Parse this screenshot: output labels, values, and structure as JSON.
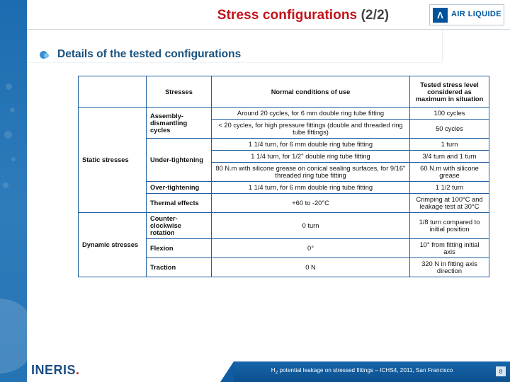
{
  "header": {
    "title_main": "Stress configurations",
    "title_suffix": "(2/2)",
    "logo": {
      "mark": "Λ",
      "line1": "AIR LIQUIDE"
    }
  },
  "section": {
    "bullet_icon": "bullet-dot-icon",
    "heading": "Details of the tested configurations"
  },
  "table": {
    "headers": {
      "blank": "",
      "stresses": "Stresses",
      "normal_conditions": "Normal conditions of use",
      "tested_level": "Tested stress level considered as maximum in situation"
    },
    "categories": [
      {
        "name": "Static stresses",
        "groups": [
          {
            "label": "Assembly-dismantling cycles",
            "rows": [
              {
                "condition": "Around 20 cycles, for 6 mm double ring tube fitting",
                "level": "100 cycles"
              },
              {
                "condition": "< 20 cycles, for high pressure fittings (double and threaded ring tube fittings)",
                "level": "50 cycles"
              }
            ]
          },
          {
            "label": "Under-tightening",
            "rows": [
              {
                "condition": "1 1/4 turn, for 6 mm double ring tube fitting",
                "level": "1 turn"
              },
              {
                "condition": "1 1/4 turn, for 1/2'' double ring tube fitting",
                "level": "3/4 turn and 1 turn"
              },
              {
                "condition": "80 N.m with silicone grease on conical sealing surfaces, for 9/16'' threaded ring tube fitting",
                "level": "60 N.m with silicone grease"
              }
            ]
          },
          {
            "label": "Over-tightening",
            "rows": [
              {
                "condition": "1 1/4 turn, for 6 mm double ring tube fitting",
                "level": "1 1/2 turn"
              }
            ]
          },
          {
            "label": "Thermal effects",
            "rows": [
              {
                "condition": "+60 to -20°C",
                "level": "Crimping at 100°C and leakage test at 30°C"
              }
            ]
          }
        ]
      },
      {
        "name": "Dynamic stresses",
        "groups": [
          {
            "label": "Counter-clockwise rotation",
            "rows": [
              {
                "condition": "0 turn",
                "level": "1/8 turn compared to initial position"
              }
            ]
          },
          {
            "label": "Flexion",
            "rows": [
              {
                "condition": "0°",
                "level": "10° from fitting initial axis"
              }
            ]
          },
          {
            "label": "Traction",
            "rows": [
              {
                "condition": "0 N",
                "level": "320 N in fitting axis direction"
              }
            ]
          }
        ]
      }
    ]
  },
  "footer": {
    "brand": "INERIS",
    "note_pre": "H",
    "note_sub": "2",
    "note_post": " potential leakage on stressed fittings – ICHS4, 2011, San Francisco",
    "page": "8"
  },
  "colors": {
    "title_red": "#c2121a",
    "heading_blue": "#18517e",
    "band_blue": "#1f6fb2",
    "table_border": "#1f5fa0",
    "footer_blue": "#0f5ca3"
  }
}
